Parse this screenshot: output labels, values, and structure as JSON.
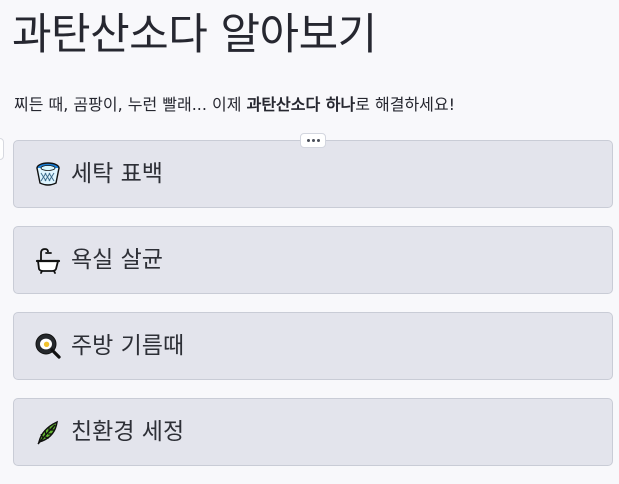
{
  "page": {
    "title": "과탄산소다 알아보기",
    "subtitle_before": "찌든 때, 곰팡이, 누런 빨래... 이제 ",
    "subtitle_bold": "과탄산소다 하나",
    "subtitle_after": "로 해결하세요!"
  },
  "buttons": [
    {
      "icon": "basket-icon",
      "label": "세탁 표백"
    },
    {
      "icon": "bathtub-icon",
      "label": "욕실 살균"
    },
    {
      "icon": "frying-pan-icon",
      "label": "주방 기름때"
    },
    {
      "icon": "leaf-icon",
      "label": "친환경 세정"
    }
  ]
}
